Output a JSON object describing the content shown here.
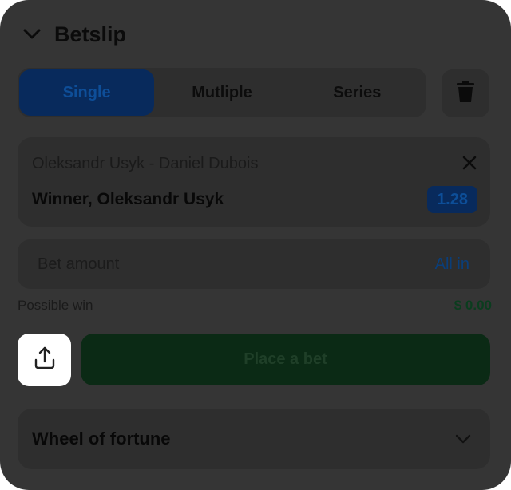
{
  "header": {
    "title": "Betslip"
  },
  "tabs": [
    {
      "label": "Single",
      "active": true
    },
    {
      "label": "Mutliple",
      "active": false
    },
    {
      "label": "Series",
      "active": false
    }
  ],
  "bet": {
    "match": "Oleksandr Usyk - Daniel Dubois",
    "outcome": "Winner, Oleksandr Usyk",
    "odds": "1.28"
  },
  "amount": {
    "placeholder": "Bet amount",
    "all_in_label": "All in"
  },
  "possible_win": {
    "label": "Possible win",
    "value": "$ 0.00"
  },
  "place_bet_label": "Place a bet",
  "wheel": {
    "label": "Wheel of fortune"
  },
  "colors": {
    "accent_blue": "#0e4e98",
    "win_green": "#0b2a15",
    "overlay": "#353535"
  },
  "icons": {
    "collapse": "chevron-down-icon",
    "trash": "trash-icon",
    "close": "close-icon",
    "share": "share-icon",
    "expand": "chevron-down-icon"
  }
}
